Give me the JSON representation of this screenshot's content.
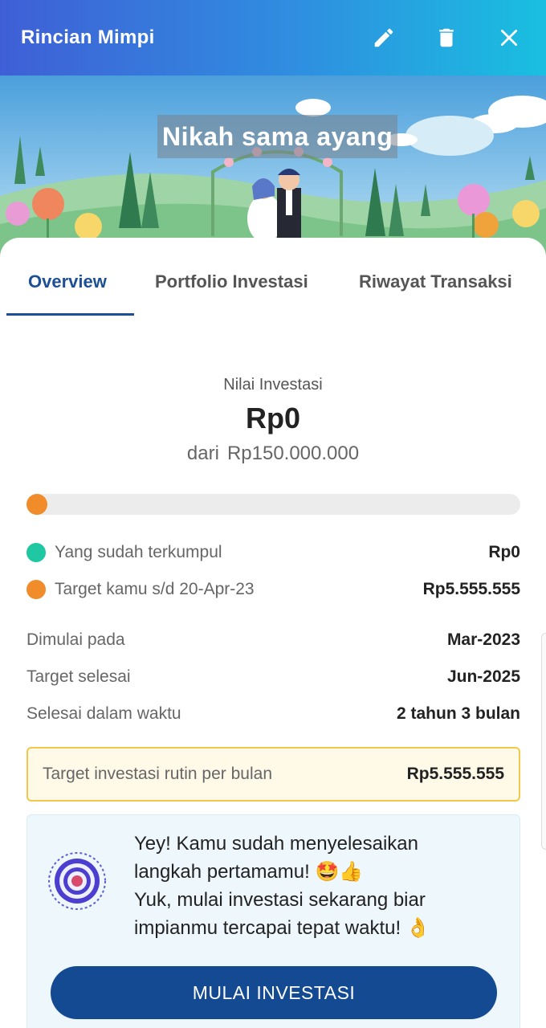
{
  "header": {
    "title": "Rincian Mimpi",
    "icons": [
      "pencil-icon",
      "trash-icon",
      "close-icon"
    ]
  },
  "banner": {
    "dream_name": "Nikah sama ayang"
  },
  "tabs": [
    {
      "label": "Overview",
      "active": true
    },
    {
      "label": "Portfolio Investasi",
      "active": false
    },
    {
      "label": "Riwayat Transaksi",
      "active": false
    }
  ],
  "investment": {
    "label": "Nilai Investasi",
    "value": "Rp0",
    "of_prefix": "dari",
    "of_target": "Rp150.000.000",
    "progress_fraction": 0.0
  },
  "legend": [
    {
      "label": "Yang sudah terkumpul",
      "value": "Rp0",
      "color": "#1fc7a2"
    },
    {
      "label": "Target kamu s/d 20-Apr-23",
      "value": "Rp5.555.555",
      "color": "#f08c2a"
    }
  ],
  "details": [
    {
      "label": "Dimulai pada",
      "value": "Mar-2023"
    },
    {
      "label": "Target selesai",
      "value": "Jun-2025"
    },
    {
      "label": "Selesai dalam waktu",
      "value": "2 tahun 3 bulan"
    }
  ],
  "routine": {
    "label": "Target investasi rutin per bulan",
    "value": "Rp5.555.555"
  },
  "promo": {
    "line1": "Yey! Kamu sudah menyelesaikan",
    "line2": "langkah pertamamu! 🤩👍",
    "line3": "Yuk, mulai investasi sekarang biar",
    "line4": "impianmu tercapai tepat waktu! 👌",
    "button": "MULAI INVESTASI"
  },
  "colors": {
    "primary": "#134a92",
    "tab_active": "#1c4f94",
    "accent_orange": "#f08c2a",
    "accent_green": "#1fc7a2",
    "highlight_border": "#f2c84a"
  }
}
